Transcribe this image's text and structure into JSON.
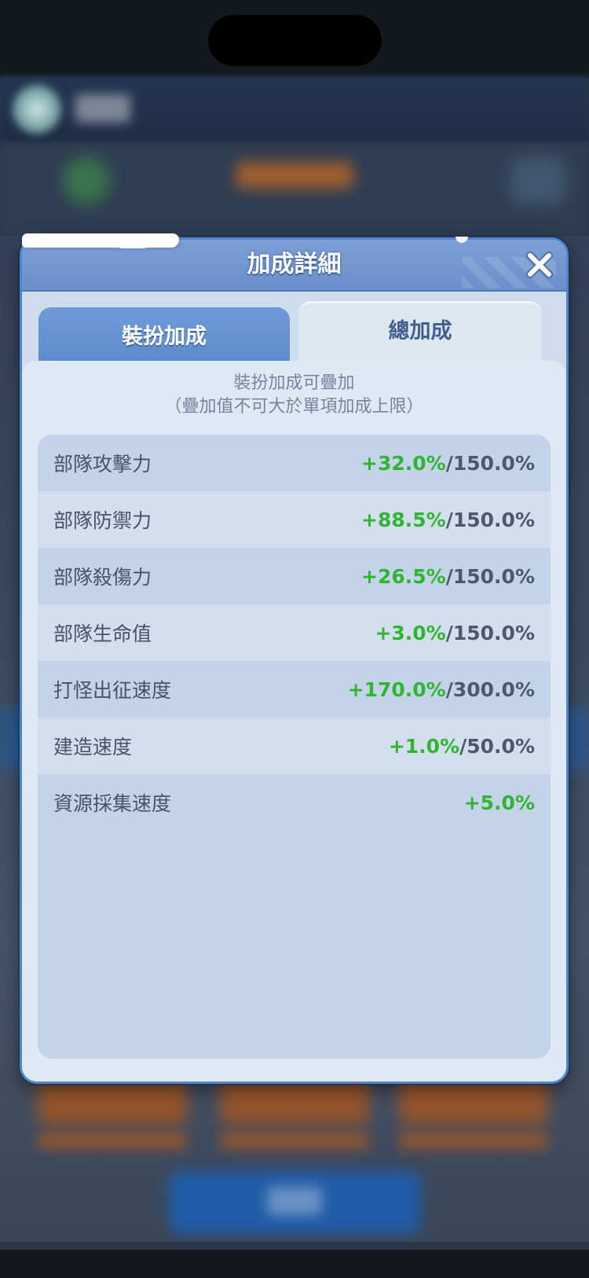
{
  "dialog": {
    "title": "加成詳細",
    "close_icon": "close-x-icon"
  },
  "tabs": [
    {
      "label": "裝扮加成",
      "selected": false
    },
    {
      "label": "總加成",
      "selected": true
    }
  ],
  "note": {
    "line1": "裝扮加成可疊加",
    "line2": "（疊加值不可大於單項加成上限）"
  },
  "stats": [
    {
      "name": "部隊攻擊力",
      "bonus": "+32.0%",
      "limit": "/150.0%"
    },
    {
      "name": "部隊防禦力",
      "bonus": "+88.5%",
      "limit": "/150.0%"
    },
    {
      "name": "部隊殺傷力",
      "bonus": "+26.5%",
      "limit": "/150.0%"
    },
    {
      "name": "部隊生命值",
      "bonus": "+3.0%",
      "limit": "/150.0%"
    },
    {
      "name": "打怪出征速度",
      "bonus": "+170.0%",
      "limit": "/300.0%"
    },
    {
      "name": "建造速度",
      "bonus": "+1.0%",
      "limit": "/50.0%"
    },
    {
      "name": "資源採集速度",
      "bonus": "+5.0%",
      "limit": ""
    }
  ],
  "colors": {
    "bonus_green": "#2fb52f",
    "dialog_border": "#4d86cf",
    "title_bar": "#7d9fd6"
  }
}
